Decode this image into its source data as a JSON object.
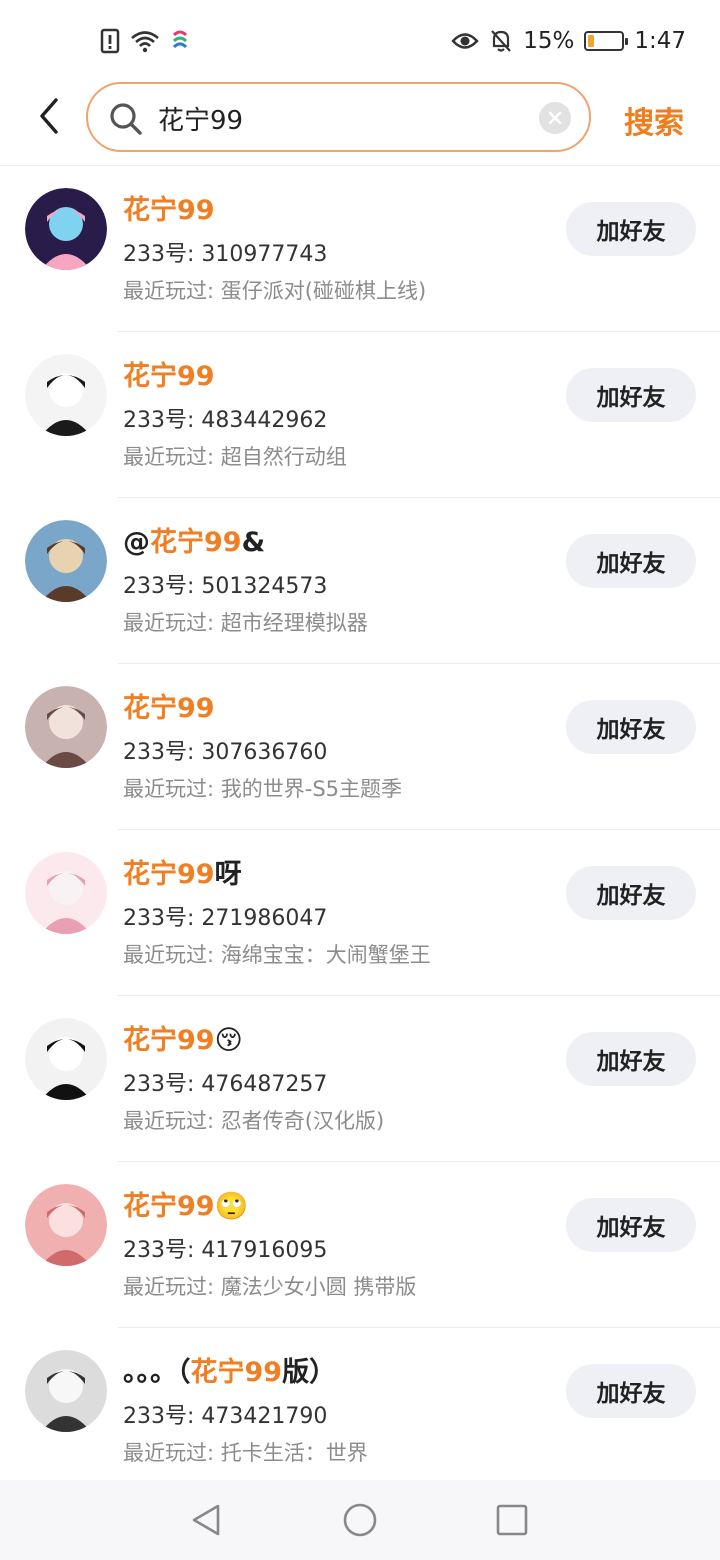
{
  "status_bar": {
    "battery_percent": "15%",
    "time": "1:47",
    "battery_level": 0.15,
    "battery_color": "#f0a531",
    "icons": [
      "sim-alert-icon",
      "wifi-icon",
      "carrier-icon",
      "eye-icon",
      "mute-bell-icon",
      "battery-icon"
    ]
  },
  "header": {
    "back_icon": "chevron-left-icon",
    "search_value": "花宁99",
    "search_label": "搜索",
    "accent_color": "#ef7f22"
  },
  "results": [
    {
      "name_prefix": "",
      "name_highlight": "花宁99",
      "name_suffix": "",
      "uid": "233号: 310977743",
      "played": "最近玩过: 蛋仔派对(碰碰棋上线)",
      "add_label": "加好友"
    },
    {
      "name_prefix": "",
      "name_highlight": "花宁99",
      "name_suffix": "",
      "uid": "233号: 483442962",
      "played": "最近玩过: 超自然行动组",
      "add_label": "加好友"
    },
    {
      "name_prefix": "@",
      "name_highlight": "花宁99",
      "name_suffix": "&",
      "uid": "233号: 501324573",
      "played": "最近玩过: 超市经理模拟器",
      "add_label": "加好友"
    },
    {
      "name_prefix": "",
      "name_highlight": "花宁99",
      "name_suffix": "",
      "uid": "233号: 307636760",
      "played": "最近玩过: 我的世界-S5主题季",
      "add_label": "加好友"
    },
    {
      "name_prefix": "",
      "name_highlight": "花宁99",
      "name_suffix": "呀",
      "uid": "233号: 271986047",
      "played": "最近玩过: 海绵宝宝：大闹蟹堡王",
      "add_label": "加好友"
    },
    {
      "name_prefix": "",
      "name_highlight": "花宁99",
      "name_suffix": "😚",
      "uid": "233号: 476487257",
      "played": "最近玩过: 忍者传奇(汉化版)",
      "add_label": "加好友"
    },
    {
      "name_prefix": "",
      "name_highlight": "花宁99",
      "name_suffix": "🙄",
      "uid": "233号: 417916095",
      "played": "最近玩过: 魔法少女小圆 携带版",
      "add_label": "加好友"
    },
    {
      "name_prefix": "。。。（",
      "name_highlight": "花宁99",
      "name_suffix": "版）",
      "uid": "233号: 473421790",
      "played": "最近玩过: 托卡生活：世界",
      "add_label": "加好友"
    }
  ],
  "nav_bar": {
    "icons": [
      "back-triangle-icon",
      "home-circle-icon",
      "recents-square-icon"
    ]
  }
}
